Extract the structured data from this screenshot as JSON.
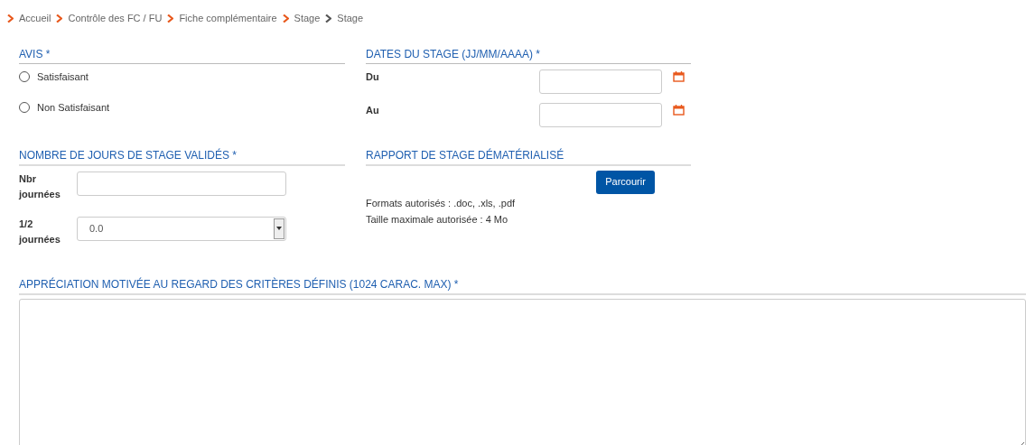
{
  "breadcrumb": [
    {
      "label": "Accueil",
      "selected": false
    },
    {
      "label": "Contrôle des FC / FU",
      "selected": false
    },
    {
      "label": "Fiche complémentaire",
      "selected": false
    },
    {
      "label": "Stage",
      "selected": false
    },
    {
      "label": "Stage",
      "selected": true
    }
  ],
  "avis": {
    "title": "AVIS *",
    "options": [
      {
        "label": "Satisfaisant",
        "selected": false
      },
      {
        "label": "Non Satisfaisant",
        "selected": false
      }
    ]
  },
  "dates": {
    "title": "DATES DU STAGE (JJ/MM/AAAA) *",
    "fields": [
      {
        "label": "Du"
      },
      {
        "label": "Au"
      }
    ]
  },
  "jours": {
    "title": "NOMBRE DE JOURS DE STAGE VALIDÉS *",
    "nbr_label": "Nbr journées",
    "demi_label": "1/2 journées",
    "demi_value": "0.0"
  },
  "rapport": {
    "title": "RAPPORT DE STAGE DÉMATÉRIALISÉ",
    "button": "Parcourir",
    "formats": "Formats autorisés : .doc, .xls, .pdf",
    "taille": "Taille maximale autorisée : 4 Mo"
  },
  "appreciation": {
    "title": "APPRÉCIATION MOTIVÉE AU REGARD DES CRITÈRES DÉFINIS (1024 CARAC. MAX) *"
  }
}
